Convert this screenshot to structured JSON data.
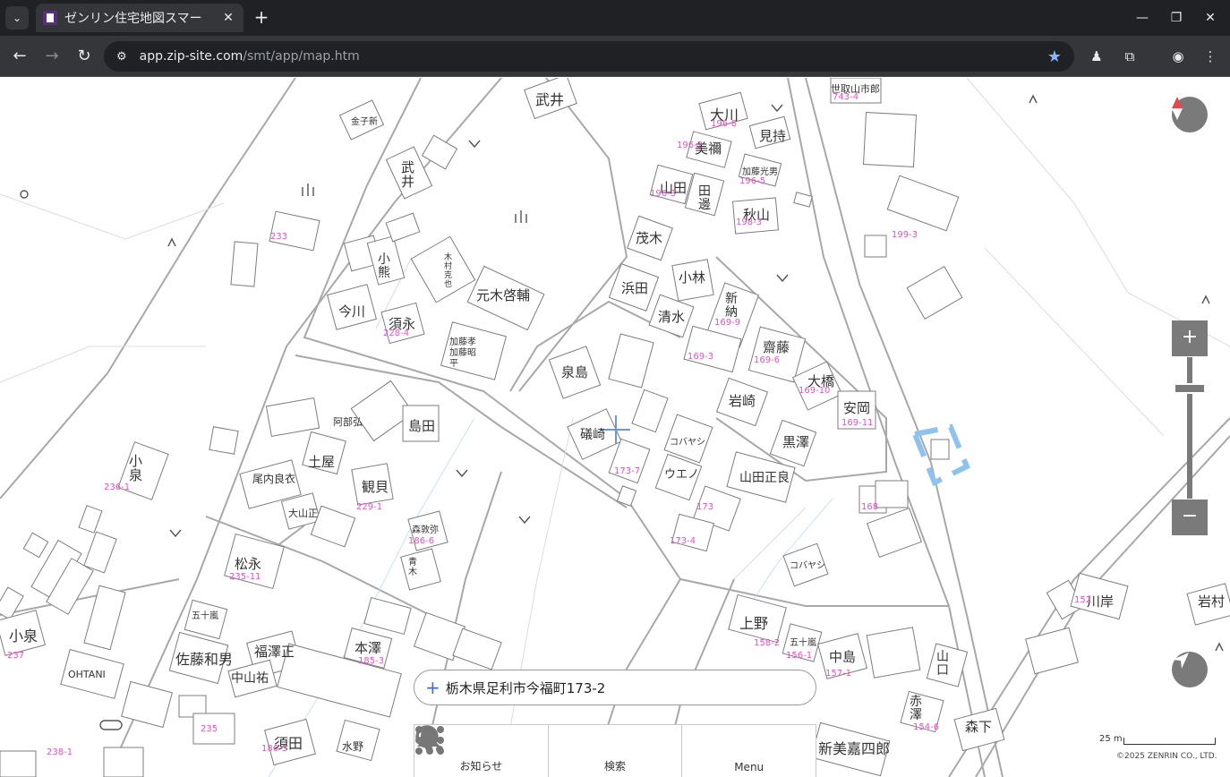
{
  "browser": {
    "tab_title": "ゼンリン住宅地図スマー",
    "url_host": "app.zip-site.com",
    "url_path": "/smt/app/map.htm"
  },
  "map": {
    "labels": {
      "takei_top": "武井",
      "ookawa": "大川",
      "mimochi": "見持",
      "miura": "美禰",
      "kato_mitsuo": "加藤光男",
      "yamada_top": "山田",
      "tanabe": "田邊",
      "akiyama": "秋山",
      "setori": "世取山市郎",
      "kaneko": "金子新",
      "takei_left": "武井",
      "shigeki": "茂木",
      "kobayashi_mid": "小林",
      "hamada": "浜田",
      "shimizu": "清水",
      "shinno": "新納",
      "saito": "齋藤",
      "ookashi": "大橋",
      "yasuoka": "安岡",
      "iwasaki": "岩崎",
      "kurosawa": "黒澤",
      "ishii": "泉島",
      "kobayashi_sato": "小熊",
      "imagawa": "今川",
      "suenaga": "須永",
      "motoki": "元木啓輔",
      "kato_shoppei": "加藤孝加藤昭平",
      "kimura": "木村克也",
      "shimada": "島田",
      "kabe": "阿部弘",
      "tsuchiya": "土屋",
      "uruho": "観貝",
      "onai": "尾内良衣",
      "ooyama": "大山正",
      "koizumi_left": "小泉",
      "matsunaga": "松永",
      "mori_tsu": "森敦弥",
      "aoki": "青木",
      "isotaka": "礒崎",
      "yamada_masaki": "山田正良",
      "kobayashi_ue": "コバヤシ",
      "ueno_kana": "ウエノ",
      "kobayashi_kana": "コバヤシ",
      "ueno": "上野",
      "isoda": "五十嵐",
      "nakajima": "中島",
      "yamaguchi": "山口",
      "akazawa": "赤澤",
      "morishita": "森下",
      "kawagishi": "川岸",
      "iwamura": "岩村",
      "shinmi": "新美嘉四郎",
      "koizumi_bottom": "小泉",
      "ohtani": "OHTANI",
      "sato_kazuo": "佐藤和男",
      "fukuzawa": "福澤正",
      "honzawa": "本澤",
      "nakayama": "中山祐",
      "suda": "須田",
      "mizuno": "水野",
      "isoda_small": "五十嵐"
    },
    "numbers": {
      "n1": "196-8",
      "n2": "196-2",
      "n3": "196-5",
      "n4": "196-3",
      "n5": "198-3",
      "n6": "743-4",
      "n7": "199-3",
      "n8": "233",
      "n9": "228-4",
      "n10": "169-9",
      "n11": "169-6",
      "n12": "169-10",
      "n13": "169-11",
      "n14": "169-3",
      "n15": "173-7",
      "n16": "173-4",
      "n17": "236-1",
      "n18": "235-11",
      "n19": "229-1",
      "n20": "186-6",
      "n21": "158-2",
      "n22": "156-1",
      "n23": "157-1",
      "n24": "154-6",
      "n25": "152",
      "n26": "168",
      "n27": "237",
      "n28": "238-1",
      "n29": "185-3",
      "n30": "186-3",
      "n31": "235",
      "n32": "173"
    }
  },
  "controls": {
    "zoom_in": "+",
    "zoom_out": "−",
    "search_text": "栃木県足利市今福町173-2",
    "bottom_nav": [
      {
        "label": "お知らせ"
      },
      {
        "label": "検索"
      },
      {
        "label": "Menu"
      }
    ],
    "scale_label": "25 m",
    "copyright": "©2025 ZENRIN CO., LTD."
  },
  "colors": {
    "chrome_bg": "#202124",
    "toolbar_bg": "#35363a",
    "map_line": "#a8a8a8",
    "number_pink": "#e055c0",
    "control_gray": "#7a7a7a",
    "highlight_blue": "#8fc2ee"
  }
}
